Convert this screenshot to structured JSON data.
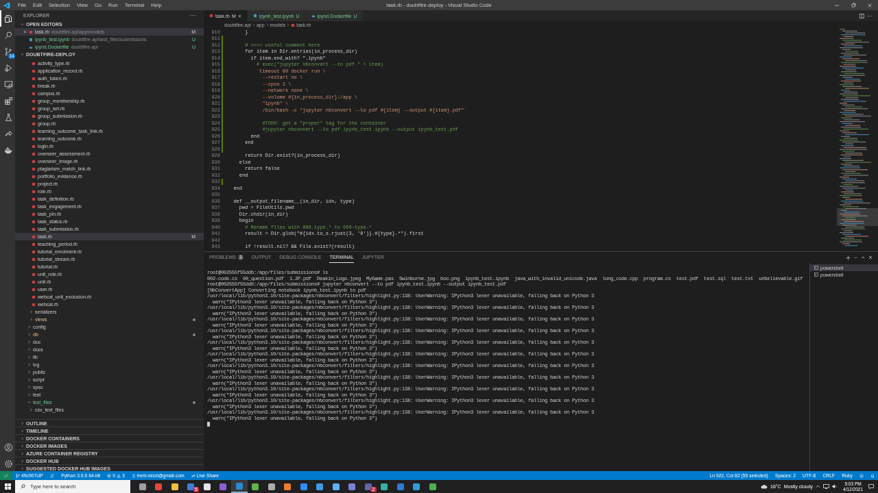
{
  "window": {
    "title": "task.rb - doubtfire-deploy - Visual Studio Code",
    "menu": [
      "File",
      "Edit",
      "Selection",
      "View",
      "Go",
      "Run",
      "Terminal",
      "Help"
    ]
  },
  "activity_bar": {
    "items": [
      {
        "kind": "explorer",
        "selected": true
      },
      {
        "kind": "search",
        "selected": false
      },
      {
        "kind": "source-control",
        "selected": false,
        "badge": "14"
      },
      {
        "kind": "run",
        "selected": false
      },
      {
        "kind": "remote",
        "selected": false
      },
      {
        "kind": "extensions",
        "selected": false
      },
      {
        "kind": "testing",
        "selected": false
      },
      {
        "kind": "live-share",
        "selected": false
      },
      {
        "kind": "docker",
        "selected": false
      }
    ],
    "bottom": [
      {
        "kind": "account"
      },
      {
        "kind": "settings"
      }
    ]
  },
  "sidebar": {
    "title": "EXPLORER",
    "open_editors": {
      "title": "OPEN EDITORS",
      "items": [
        {
          "name": "task.rb",
          "path": "doubtfire-api\\app\\models",
          "badge": "M",
          "kind": "ruby",
          "selected": true
        },
        {
          "name": "ipynb_test.ipynb",
          "path": "doubtfire-api\\test_files\\submissions",
          "badge": "U",
          "kind": "notebook",
          "selected": false
        },
        {
          "name": "ipynd.Dockerfile",
          "path": "doubtfire-api",
          "badge": "U",
          "kind": "docker",
          "selected": false
        }
      ]
    },
    "project": {
      "title": "DOUBTFIRE-DEPLOY",
      "tree": [
        {
          "children": [
            {
              "children": [
                {
                  "name": "activity_type.rb",
                  "selected": false
                },
                {
                  "name": "application_record.rb",
                  "selected": false
                },
                {
                  "name": "auth_token.rb",
                  "selected": false
                },
                {
                  "name": "break.rb",
                  "selected": false
                },
                {
                  "name": "campus.rb",
                  "selected": false
                },
                {
                  "name": "group_membership.rb",
                  "selected": false
                },
                {
                  "name": "group_set.rb",
                  "selected": false
                },
                {
                  "name": "group_submission.rb",
                  "selected": false
                },
                {
                  "name": "group.rb",
                  "selected": false
                },
                {
                  "name": "learning_outcome_task_link.rb",
                  "selected": false
                },
                {
                  "name": "learning_outcome.rb",
                  "selected": false
                },
                {
                  "name": "login.rb",
                  "selected": false
                },
                {
                  "name": "overseer_assessment.rb",
                  "selected": false
                },
                {
                  "name": "overseer_image.rb",
                  "selected": false
                },
                {
                  "name": "plagiarism_match_link.rb",
                  "selected": false
                },
                {
                  "name": "portfolio_evidence.rb",
                  "selected": false
                },
                {
                  "name": "project.rb",
                  "selected": false
                },
                {
                  "name": "role.rb",
                  "selected": false
                },
                {
                  "name": "task_definition.rb",
                  "selected": false
                },
                {
                  "name": "task_engagement.rb",
                  "selected": false
                },
                {
                  "name": "task_pin.rb",
                  "selected": false
                },
                {
                  "name": "task_status.rb",
                  "selected": false
                },
                {
                  "name": "task_submission.rb",
                  "selected": false
                },
                {
                  "name": "task.rb",
                  "selected": true,
                  "badge": "M"
                },
                {
                  "name": "teaching_period.rb",
                  "selected": false
                },
                {
                  "name": "tutorial_enrolment.rb",
                  "selected": false
                },
                {
                  "name": "tutorial_stream.rb",
                  "selected": false
                },
                {
                  "name": "tutorial.rb",
                  "selected": false
                },
                {
                  "name": "unit_role.rb",
                  "selected": false
                },
                {
                  "name": "unit.rb",
                  "selected": false
                },
                {
                  "name": "user.rb",
                  "selected": false
                },
                {
                  "name": "webcal_unit_exclusion.rb",
                  "selected": false
                },
                {
                  "name": "webcal.rb",
                  "selected": false
                }
              ]
            },
            {
              "name": "serializers",
              "folder": true,
              "expanded": false,
              "selected": false
            },
            {
              "name": "views",
              "folder": true,
              "expanded": false,
              "selected": false,
              "modified": true
            }
          ]
        },
        {
          "name": "config",
          "folder": true,
          "expanded": false,
          "selected": false
        },
        {
          "name": "db",
          "folder": true,
          "expanded": false,
          "selected": false,
          "modified": true
        },
        {
          "name": "doc",
          "folder": true,
          "expanded": false,
          "selected": false
        },
        {
          "name": "docs",
          "folder": true,
          "expanded": false,
          "selected": false
        },
        {
          "name": "lib",
          "folder": true,
          "expanded": false,
          "selected": false
        },
        {
          "name": "log",
          "folder": true,
          "expanded": false,
          "selected": false
        },
        {
          "name": "public",
          "folder": true,
          "expanded": false,
          "selected": false
        },
        {
          "name": "script",
          "folder": true,
          "expanded": false,
          "selected": false
        },
        {
          "name": "spec",
          "folder": true,
          "expanded": false,
          "selected": false
        },
        {
          "name": "test",
          "folder": true,
          "expanded": false,
          "selected": false
        },
        {
          "name": "test_files",
          "folder": true,
          "expanded": true,
          "selected": false,
          "untracked": true,
          "children": [
            {
              "name": "csv_test_files",
              "folder": true,
              "expanded": false,
              "selected": false
            }
          ]
        }
      ]
    },
    "sections": [
      "OUTLINE",
      "TIMELINE",
      "DOCKER CONTAINERS",
      "DOCKER IMAGES",
      "AZURE CONTAINER REGISTRY",
      "DOCKER HUB",
      "SUGGESTED DOCKER HUB IMAGES"
    ]
  },
  "editor": {
    "tabs": [
      {
        "name": "task.rb",
        "badge": "M",
        "kind": "ruby",
        "selected": true
      },
      {
        "name": "ipynb_test.ipynb",
        "badge": "U",
        "kind": "notebook",
        "selected": false
      },
      {
        "name": "ipynd.Dockerfile",
        "badge": "U",
        "kind": "docker",
        "selected": false
      }
    ],
    "breadcrumbs": [
      "doubtfire-api",
      "app",
      "models",
      "task.rb"
    ],
    "lines": [
      {
        "num": "910",
        "text": "      }",
        "kind": "code",
        "changed": false
      },
      {
        "num": "911",
        "changed": true
      },
      {
        "num": "912",
        "text": "      # >>>> useful comment here",
        "kind": "comment",
        "changed": true
      },
      {
        "num": "913",
        "text": "      for item in Dir.entries(in_process_dir)",
        "kind": "code",
        "changed": true
      },
      {
        "num": "914",
        "text": "        if item.end_with? \".ipynb\"",
        "kind": "code",
        "changed": true
      },
      {
        "num": "915",
        "text": "          # exec(\"jupyter nbconvert --to pdf \" + item)",
        "kind": "comment",
        "changed": true
      },
      {
        "num": "916",
        "text": "          `timeout 60 docker run \\",
        "kind": "string",
        "changed": true
      },
      {
        "num": "917",
        "text": "            --restart no \\",
        "kind": "string",
        "changed": true
      },
      {
        "num": "918",
        "text": "            --cpus 1 \\",
        "kind": "string",
        "changed": true
      },
      {
        "num": "919",
        "text": "            --network none \\",
        "kind": "string",
        "changed": true
      },
      {
        "num": "920",
        "text": "            --volume #{in_process_dir}:/app \\",
        "kind": "string",
        "changed": true
      },
      {
        "num": "921",
        "text": "            \"ipynb\" \\",
        "kind": "string",
        "changed": true
      },
      {
        "num": "922",
        "text": "            /bin/bash -c \"jupyter nbconvert --to pdf #{item} --output #{item}.pdf\"`",
        "kind": "string",
        "changed": true
      },
      {
        "num": "923",
        "changed": true
      },
      {
        "num": "924",
        "text": "            #TODO: get a \"proper\" tag for the container",
        "kind": "comment",
        "changed": true
      },
      {
        "num": "925",
        "text": "            #jupyter nbconvert --to pdf ipynb_test.ipynb --output ipynb_test.pdf",
        "kind": "comment",
        "changed": true
      },
      {
        "num": "926",
        "text": "        end",
        "kind": "code",
        "changed": true
      },
      {
        "num": "927",
        "text": "      end",
        "kind": "code",
        "changed": true
      },
      {
        "num": "928",
        "changed": true
      },
      {
        "num": "929",
        "text": "      return Dir.exist?(in_process_dir)",
        "kind": "code",
        "changed": false
      },
      {
        "num": "930",
        "text": "    else",
        "kind": "code",
        "changed": false
      },
      {
        "num": "931",
        "text": "      return false",
        "kind": "code",
        "changed": false
      },
      {
        "num": "932",
        "text": "    end",
        "kind": "code",
        "changed": false
      },
      {
        "num": "933",
        "changed": true
      },
      {
        "num": "934",
        "text": "  end",
        "kind": "code",
        "changed": false
      },
      {
        "num": "935",
        "changed": false
      },
      {
        "num": "936",
        "text": "  def __output_filename__(in_dir, idx, type)",
        "kind": "code",
        "changed": false
      },
      {
        "num": "937",
        "text": "    pwd = FileUtils.pwd",
        "kind": "code",
        "changed": false
      },
      {
        "num": "938",
        "text": "    Dir.chdir(in_dir)",
        "kind": "code",
        "changed": false
      },
      {
        "num": "939",
        "text": "    begin",
        "kind": "code",
        "changed": false
      },
      {
        "num": "940",
        "text": "      # Rename files with 000.type.* to 000-type-*",
        "kind": "comment",
        "changed": false
      },
      {
        "num": "941",
        "text": "      result = Dir.glob(\"#{idx.to_s.rjust(3, '0')}.#{type}.*\").first",
        "kind": "code",
        "changed": false
      },
      {
        "num": "942",
        "changed": false
      },
      {
        "num": "943",
        "text": "      if !result.nil? && File.exist?(result)",
        "kind": "code",
        "changed": false
      }
    ]
  },
  "panel": {
    "tabs": [
      {
        "label": "PROBLEMS",
        "badge": "3",
        "selected": false
      },
      {
        "label": "OUTPUT",
        "selected": false
      },
      {
        "label": "DEBUG CONSOLE",
        "selected": false
      },
      {
        "label": "TERMINAL",
        "selected": true
      },
      {
        "label": "JUPYTER",
        "selected": false
      }
    ],
    "terminal_lines": [
      "root@002555f55ddb:/app/files/submissions# ls",
      "002-code.cs  00_question.pdf  1.2P.pdf  Deakin_Logo.jpeg  MyGame.pas  Swinburne.jpg  boo.png  ipynb_test.ipynb  java_with_invalid_unicode.java  long_code.cpp  program.cs  test.pdf  test.sql  test.txt  unbelievable.gif",
      "root@002555f55ddb:/app/files/submissions# jupyter nbconvert --to pdf ipynb_test.ipynb --output ipynb_test.pdf",
      "[NbConvertApp] Converting notebook ipynb_test.ipynb to pdf",
      "/usr/local/lib/python3.10/site-packages/nbconvert/filters/highlight.py:138: UserWarning: IPython3 lexer unavailable, falling back on Python 3",
      "  warn(\"IPython3 lexer unavailable, falling back on Python 3\")",
      "/usr/local/lib/python3.10/site-packages/nbconvert/filters/highlight.py:138: UserWarning: IPython3 lexer unavailable, falling back on Python 3",
      "  warn(\"IPython3 lexer unavailable, falling back on Python 3\")",
      "/usr/local/lib/python3.10/site-packages/nbconvert/filters/highlight.py:138: UserWarning: IPython3 lexer unavailable, falling back on Python 3",
      "  warn(\"IPython3 lexer unavailable, falling back on Python 3\")",
      "/usr/local/lib/python3.10/site-packages/nbconvert/filters/highlight.py:138: UserWarning: IPython3 lexer unavailable, falling back on Python 3",
      "  warn(\"IPython3 lexer unavailable, falling back on Python 3\")",
      "/usr/local/lib/python3.10/site-packages/nbconvert/filters/highlight.py:138: UserWarning: IPython3 lexer unavailable, falling back on Python 3",
      "  warn(\"IPython3 lexer unavailable, falling back on Python 3\")",
      "/usr/local/lib/python3.10/site-packages/nbconvert/filters/highlight.py:138: UserWarning: IPython3 lexer unavailable, falling back on Python 3",
      "  warn(\"IPython3 lexer unavailable, falling back on Python 3\")",
      "/usr/local/lib/python3.10/site-packages/nbconvert/filters/highlight.py:138: UserWarning: IPython3 lexer unavailable, falling back on Python 3",
      "  warn(\"IPython3 lexer unavailable, falling back on Python 3\")",
      "/usr/local/lib/python3.10/site-packages/nbconvert/filters/highlight.py:138: UserWarning: IPython3 lexer unavailable, falling back on Python 3",
      "  warn(\"IPython3 lexer unavailable, falling back on Python 3\")",
      "/usr/local/lib/python3.10/site-packages/nbconvert/filters/highlight.py:138: UserWarning: IPython3 lexer unavailable, falling back on Python 3",
      "  warn(\"IPython3 lexer unavailable, falling back on Python 3\")",
      "/usr/local/lib/python3.10/site-packages/nbconvert/filters/highlight.py:138: UserWarning: IPython3 lexer unavailable, falling back on Python 3",
      "  warn(\"IPython3 lexer unavailable, falling back on Python 3\")",
      "/usr/local/lib/python3.10/site-packages/nbconvert/filters/highlight.py:138: UserWarning: IPython3 lexer unavailable, falling back on Python 3",
      "  warn(\"IPython3 lexer unavailable, falling back on Python 3\")"
    ],
    "terminals": [
      {
        "name": "powershell",
        "selected": true
      },
      {
        "name": "powershell",
        "selected": false
      }
    ]
  },
  "status_bar": {
    "left": [
      {
        "kind": "remote"
      },
      {
        "kind": "branch",
        "text": "49c907c8*"
      },
      {
        "kind": "sync"
      },
      {
        "kind": "text",
        "text": "Python 3.9.6 64-bit"
      },
      {
        "kind": "problems",
        "errors": "0",
        "warnings": "3"
      },
      {
        "kind": "account",
        "text": "trent.mizzi@gmail.com"
      },
      {
        "kind": "live-share",
        "text": "Live Share"
      }
    ],
    "right": [
      {
        "kind": "text",
        "text": "Ln 922, Col 82 (55 selected)"
      },
      {
        "kind": "text",
        "text": "Spaces: 2"
      },
      {
        "kind": "text",
        "text": "UTF-8"
      },
      {
        "kind": "text",
        "text": "CRLF"
      },
      {
        "kind": "text",
        "text": "Ruby"
      },
      {
        "kind": "feedback"
      },
      {
        "kind": "bell"
      }
    ]
  },
  "taskbar": {
    "search": {
      "placeholder": "Type here to search"
    },
    "apps": [
      {
        "color": "#9aa0a6",
        "selected": false
      },
      {
        "color": "#e8453c",
        "selected": false
      },
      {
        "color": "#f3c03d",
        "selected": false
      },
      {
        "color": "#3b7ddd",
        "selected": false,
        "badge": "5"
      },
      {
        "color": "#e6e6e6",
        "selected": false
      },
      {
        "color": "#8e5bd6",
        "selected": false
      },
      {
        "color": "#2a8ad4",
        "selected": true
      },
      {
        "color": "#5fb548",
        "selected": false
      },
      {
        "color": "#ababab",
        "selected": false
      },
      {
        "color": "#f07a30",
        "selected": false
      },
      {
        "color": "#2d8cff",
        "selected": false
      },
      {
        "color": "#3d9be9",
        "selected": false
      },
      {
        "color": "#5cb0ff",
        "selected": false
      },
      {
        "color": "#7a7fd8",
        "selected": false
      },
      {
        "color": "#6264a7",
        "selected": false,
        "badge": "2"
      },
      {
        "color": "#33b3a6",
        "selected": false
      },
      {
        "color": "#2b7cd3",
        "selected": false
      },
      {
        "color": "#2f9be0",
        "selected": false
      },
      {
        "color": "#4caf50",
        "selected": false
      }
    ],
    "weather": {
      "temp": "16°C",
      "condition": "Mostly cloudy"
    },
    "time": "5:03 PM",
    "date": "4/12/2021"
  }
}
